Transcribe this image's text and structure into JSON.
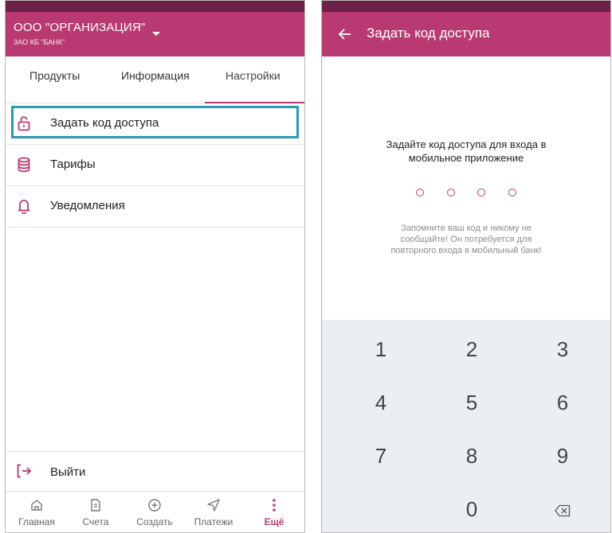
{
  "left": {
    "org_name": "ООО \"ОРГАНИЗАЦИЯ\"",
    "org_sub": "ЗАО КБ \"БАНК\"",
    "tabs": [
      {
        "label": "Продукты"
      },
      {
        "label": "Информация"
      },
      {
        "label": "Настройки"
      }
    ],
    "active_tab": "Настройки",
    "menu": [
      {
        "icon": "lock-icon",
        "label": "Задать код доступа"
      },
      {
        "icon": "database-icon",
        "label": "Тарифы"
      },
      {
        "icon": "bell-icon",
        "label": "Уведомления"
      }
    ],
    "logout": {
      "icon": "logout-icon",
      "label": "Выйти"
    },
    "bottom_nav": [
      {
        "icon": "home-icon",
        "label": "Главная"
      },
      {
        "icon": "document-icon",
        "label": "Счета"
      },
      {
        "icon": "plus-circle-icon",
        "label": "Создать"
      },
      {
        "icon": "send-icon",
        "label": "Платежи"
      },
      {
        "icon": "more-vertical-icon",
        "label": "Ещё"
      }
    ],
    "active_nav": "Ещё"
  },
  "right": {
    "title": "Задать код доступа",
    "prompt_line1": "Задайте код доступа для входа в",
    "prompt_line2": "мобильное приложение",
    "hint_line1": "Запомните ваш код и никому не",
    "hint_line2": "сообщайте! Он потребуется для",
    "hint_line3": "повторного входа в мобильный банк!",
    "keys": [
      "1",
      "2",
      "3",
      "4",
      "5",
      "6",
      "7",
      "8",
      "9",
      "0"
    ],
    "backspace_icon": "backspace-icon"
  },
  "colors": {
    "accent": "#b93a72",
    "statusbar": "#6e2148",
    "highlight": "#2d98b2",
    "keypad_bg": "#eceff1"
  }
}
